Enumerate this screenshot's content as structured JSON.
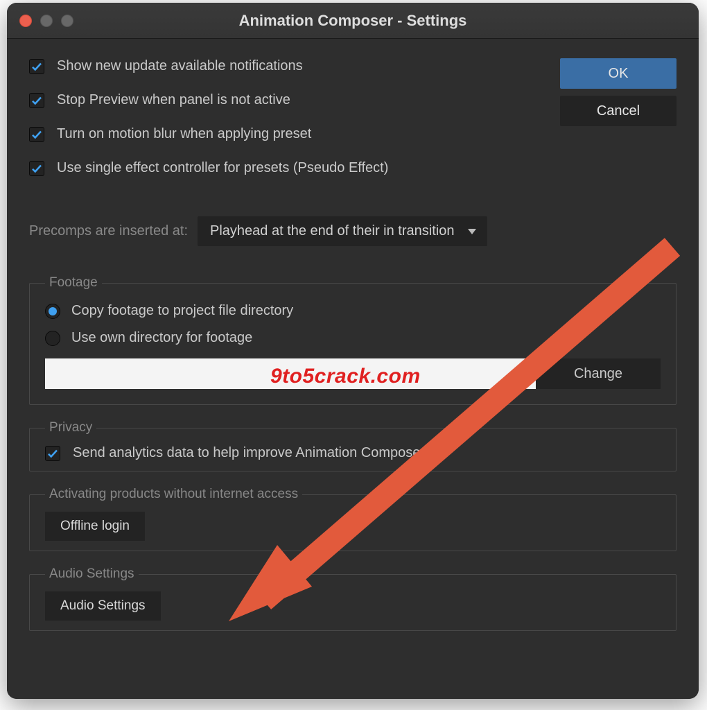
{
  "window": {
    "title": "Animation Composer - Settings"
  },
  "buttons": {
    "ok": "OK",
    "cancel": "Cancel"
  },
  "checks": {
    "update_notifications": "Show new update available notifications",
    "stop_preview": "Stop Preview when panel is not active",
    "motion_blur": "Turn on motion blur when applying preset",
    "single_effect": "Use single effect controller for presets (Pseudo Effect)"
  },
  "precomps": {
    "label": "Precomps are inserted at:",
    "selected": "Playhead at the end of their in transition"
  },
  "footage": {
    "legend": "Footage",
    "copy_label": "Copy footage to project file directory",
    "own_label": "Use own directory for footage",
    "dir_value": "",
    "change": "Change"
  },
  "privacy": {
    "legend": "Privacy",
    "analytics": "Send analytics data to help improve Animation Composer"
  },
  "activation": {
    "legend": "Activating products without internet access",
    "offline_login": "Offline login"
  },
  "audio": {
    "legend": "Audio Settings",
    "button": "Audio Settings"
  },
  "watermark": "9to5crack.com",
  "colors": {
    "accent": "#3a6ea5",
    "arrow": "#e25a3c"
  }
}
